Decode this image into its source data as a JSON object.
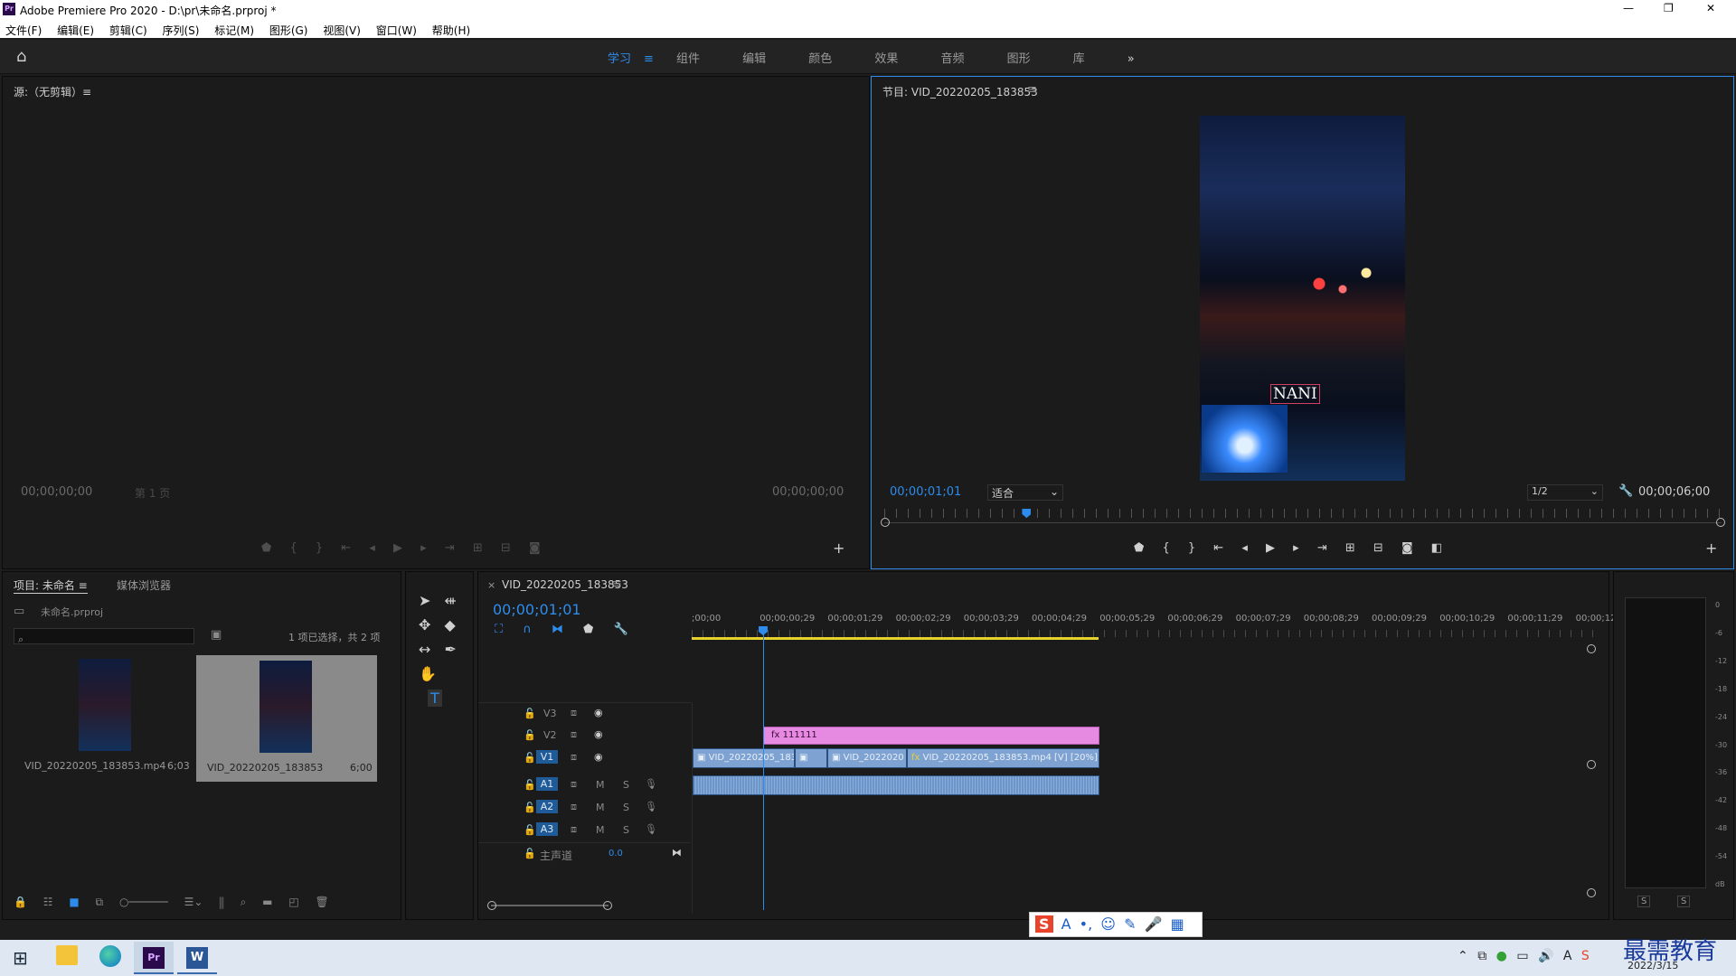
{
  "window": {
    "title": "Adobe Premiere Pro 2020 - D:\\pr\\未命名.prproj *",
    "minimize": "—",
    "maximize": "❐",
    "close": "✕"
  },
  "menu": [
    "文件(F)",
    "编辑(E)",
    "剪辑(C)",
    "序列(S)",
    "标记(M)",
    "图形(G)",
    "视图(V)",
    "窗口(W)",
    "帮助(H)"
  ],
  "workspaces": {
    "tabs": [
      "学习",
      "组件",
      "编辑",
      "颜色",
      "效果",
      "音频",
      "图形",
      "库"
    ],
    "active": "学习",
    "more": "»"
  },
  "source": {
    "title": "源:（无剪辑）≡",
    "timecode_left": "00;00;00;00",
    "timecode_right": "00;00;00;00",
    "page": "第 1 页"
  },
  "program": {
    "title": "节目: VID_20220205_183853",
    "timecode": "00;00;01;01",
    "fit": "适合",
    "resolution": "1/2",
    "duration": "00;00;06;00",
    "overlay_text": "NANI",
    "playhead_fraction": 0.17
  },
  "project": {
    "tab_project": "项目: 未命名",
    "tab_media": "媒体浏览器",
    "file": "未命名.prproj",
    "selection": "1 项已选择，共 2 项",
    "items": [
      {
        "name": "VID_20220205_183853.mp4",
        "duration": "6;03"
      },
      {
        "name": "VID_20220205_183853",
        "duration": "6;00"
      }
    ]
  },
  "timeline": {
    "tab": "VID_20220205_183853",
    "timecode": "00;00;01;01",
    "ruler": [
      ";00;00",
      "00;00;00;29",
      "00;00;01;29",
      "00;00;02;29",
      "00;00;03;29",
      "00;00;04;29",
      "00;00;05;29",
      "00;00;06;29",
      "00;00;07;29",
      "00;00;08;29",
      "00;00;09;29",
      "00;00;10;29",
      "00;00;11;29",
      "00;00;12"
    ],
    "tracks": [
      "V3",
      "V2",
      "V1",
      "A1",
      "A2",
      "A3"
    ],
    "master": {
      "label": "主声道",
      "value": "0.0"
    },
    "title_clip": "111111",
    "v1_clips": [
      "VID_20220205_183",
      "VID_2022020",
      "VID_20220205_183853.mp4 [V] [20%]"
    ]
  },
  "meter": {
    "scale": [
      "0",
      "-6",
      "-12",
      "-18",
      "-24",
      "-30",
      "-36",
      "-42",
      "-48",
      "-54",
      "dB"
    ],
    "solo": "S"
  },
  "taskbar": {
    "date": "2022/3/15",
    "watermark": "最需教育"
  }
}
